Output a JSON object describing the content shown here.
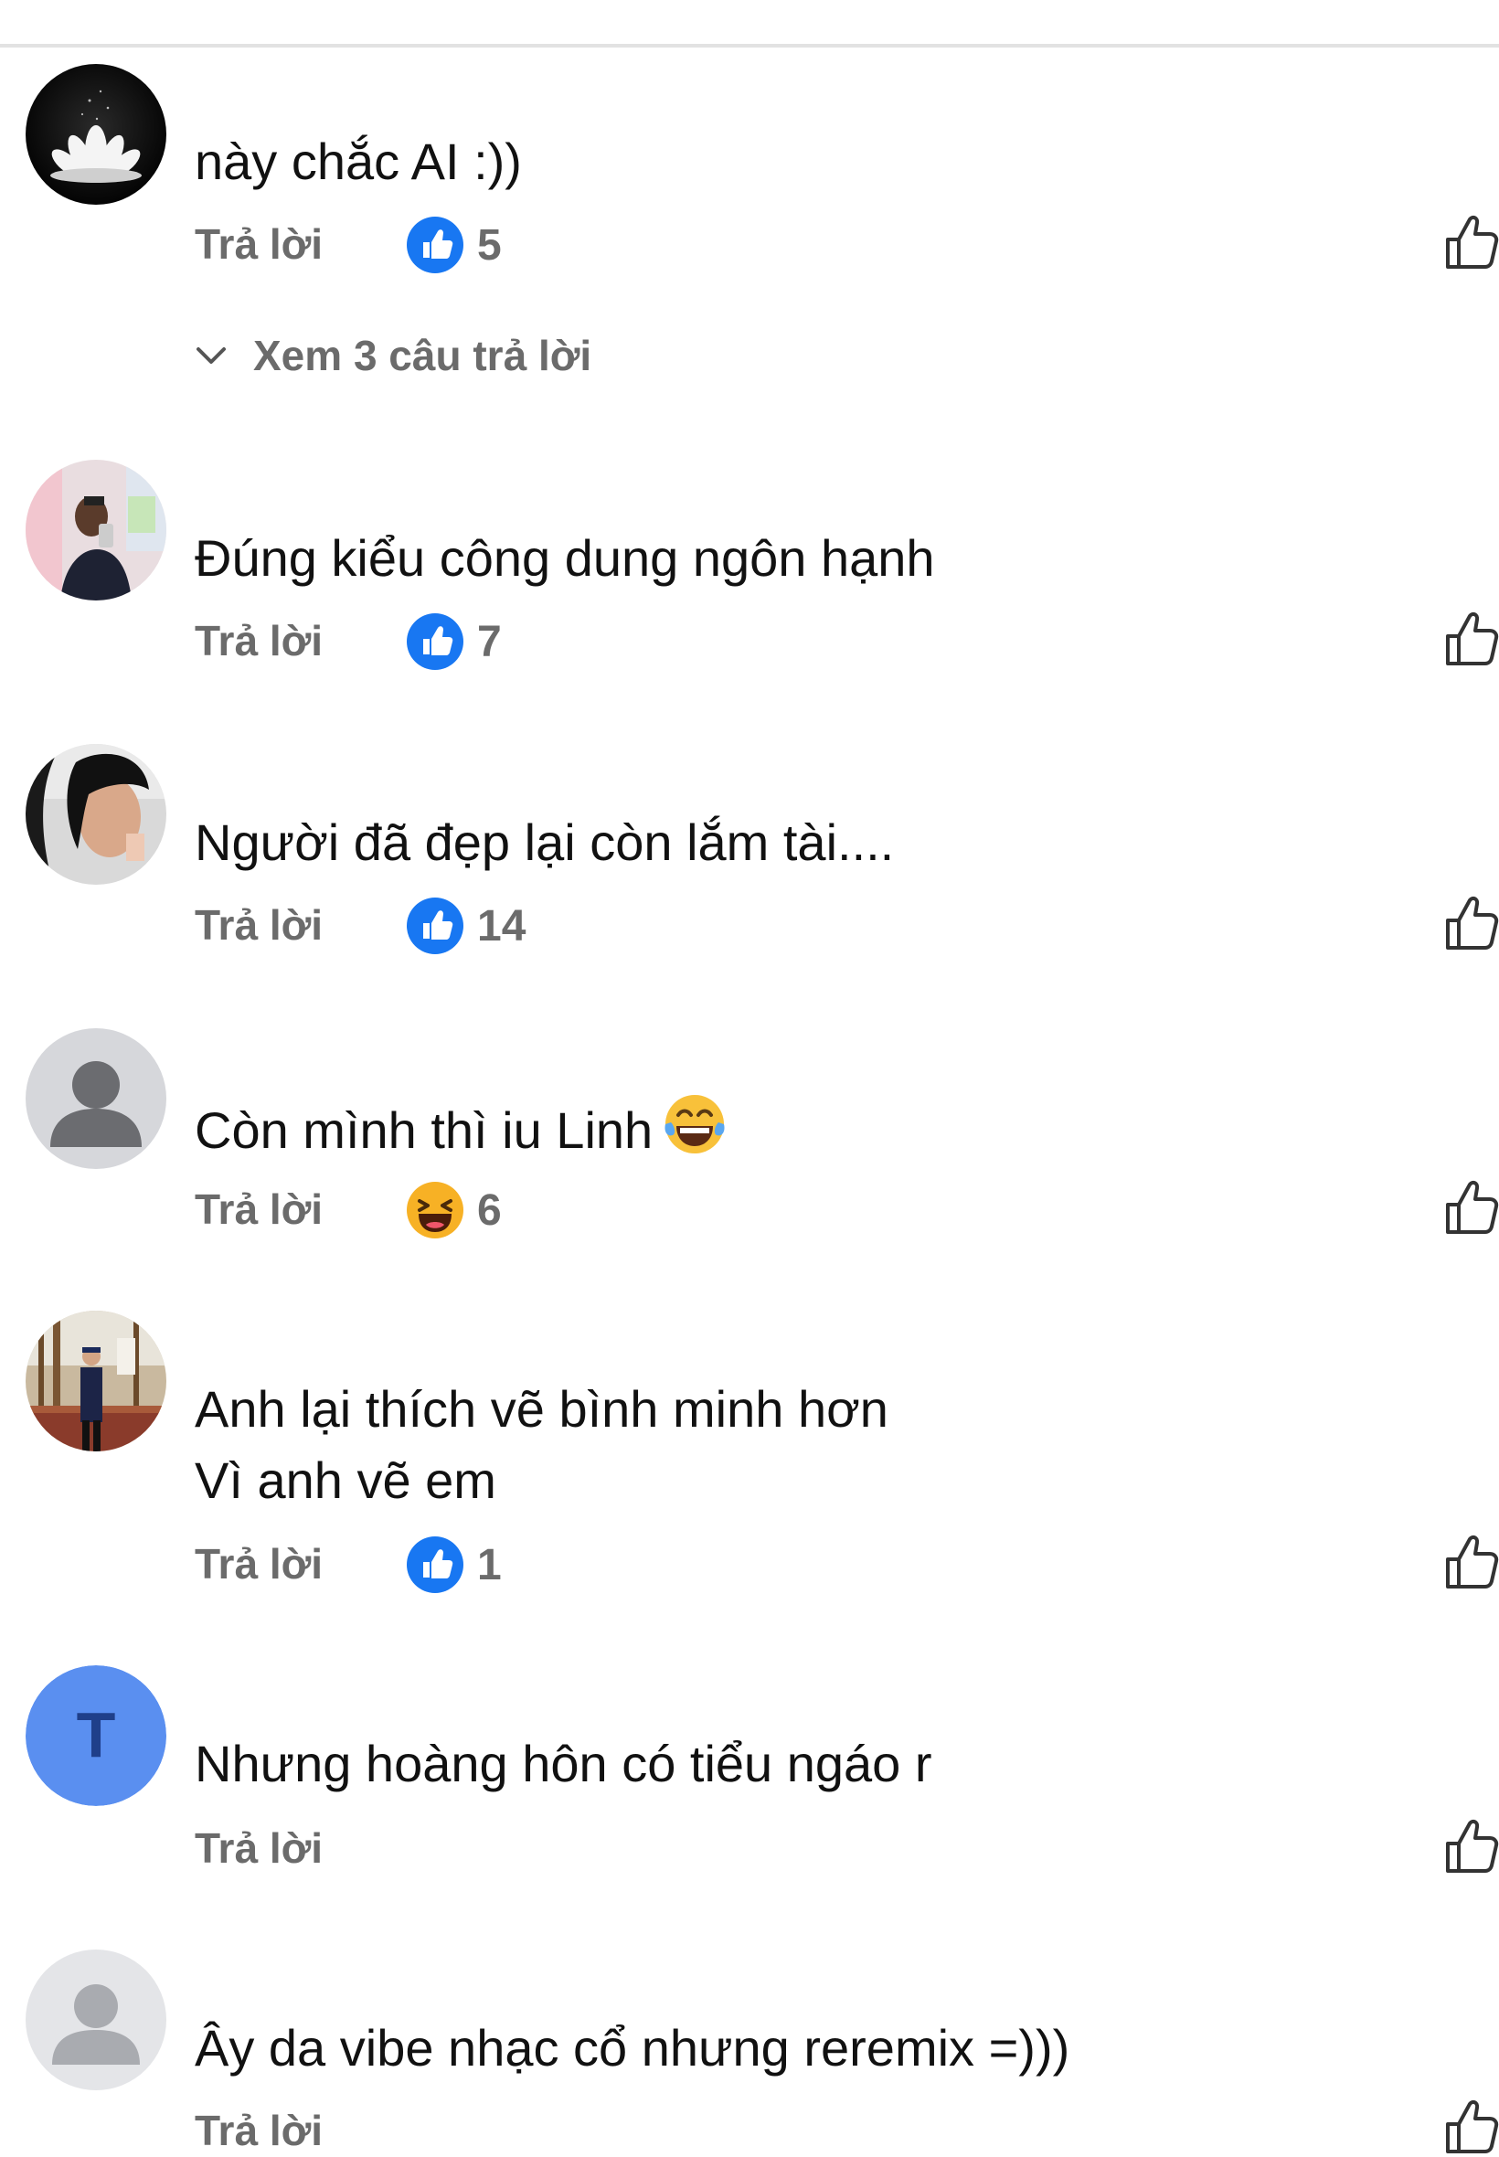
{
  "comments": [
    {
      "avatar": "lotus-avatar",
      "lines": [
        "này chắc AI :))"
      ],
      "reply_label": "Trả lời",
      "reaction": "like-reaction",
      "count": "5",
      "view_replies": "Xem 3 câu trả lời"
    },
    {
      "avatar": "selfie-avatar",
      "lines": [
        "Đúng kiểu công dung ngôn hạnh"
      ],
      "reply_label": "Trả lời",
      "reaction": "like-reaction",
      "count": "7"
    },
    {
      "avatar": "portrait-avatar",
      "lines": [
        "Người đã đẹp lại còn lắm tài...."
      ],
      "reply_label": "Trả lời",
      "reaction": "like-reaction",
      "count": "14"
    },
    {
      "avatar": "default-avatar",
      "lines": [
        "Còn mình thì iu Linh"
      ],
      "inline_emoji": "laughing-tears-emoji",
      "reply_label": "Trả lời",
      "reaction": "haha-reaction",
      "count": "6"
    },
    {
      "avatar": "landscape-avatar",
      "lines": [
        "Anh lại thích vẽ bình minh hơn",
        "Vì anh vẽ em"
      ],
      "reply_label": "Trả lời",
      "reaction": "like-reaction",
      "count": "1"
    },
    {
      "avatar": "letter-avatar",
      "avatar_letter": "T",
      "lines": [
        "Nhưng hoàng hôn có tiểu ngáo r"
      ],
      "reply_label": "Trả lời"
    },
    {
      "avatar": "default-avatar",
      "lines": [
        "Ây da vibe nhạc cổ nhưng reremix =)))"
      ],
      "reply_label": "Trả lời"
    }
  ],
  "colors": {
    "like_blue": "#1877f2",
    "muted_text": "#6b6b6b",
    "letter_avatar_bg": "#5a8ff0"
  }
}
